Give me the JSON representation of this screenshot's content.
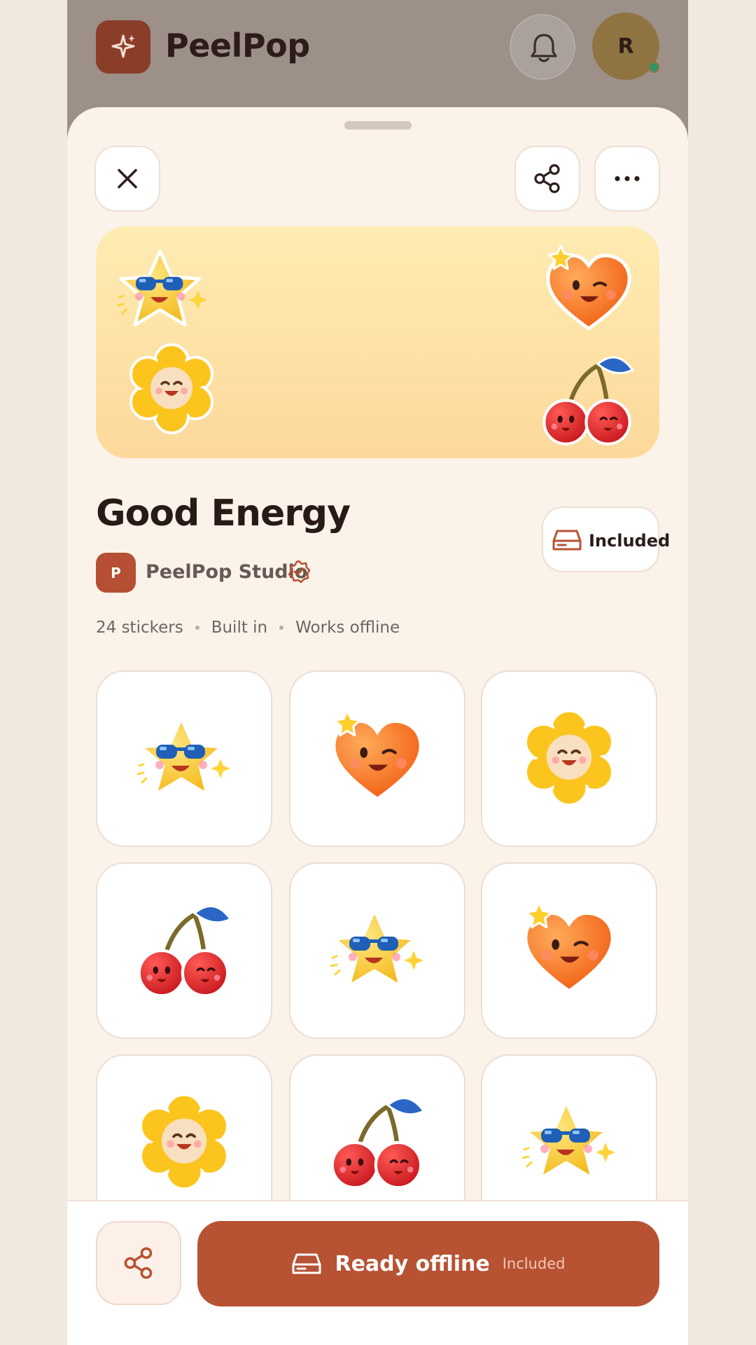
{
  "app": {
    "name": "PeelPop",
    "avatar_initial": "R",
    "icons": {
      "logo": "sparkle-icon",
      "notifications": "bell-icon"
    }
  },
  "sheet": {
    "close_icon": "close-icon",
    "share_icon": "share-icon",
    "more_icon": "more-horizontal-icon"
  },
  "pack": {
    "title": "Good Energy",
    "creator_initial": "P",
    "creator_name": "PeelPop Studio",
    "verified_icon": "verified-badge-icon",
    "status_chip": "Included",
    "meta": [
      "24 stickers",
      "Built in",
      "Works offline"
    ],
    "banner_stickers": [
      "star-sunglasses",
      "heart-wink",
      "flower-smile",
      "cherries-smile"
    ]
  },
  "stickers": [
    "star-sunglasses",
    "heart-wink",
    "flower-smile",
    "cherries-smile",
    "star-sunglasses",
    "heart-wink",
    "flower-smile",
    "cherries-smile",
    "star-sunglasses"
  ],
  "bottom_bar": {
    "primary_label": "Ready offline",
    "primary_sublabel": "Included",
    "primary_icon": "storage-drive-icon",
    "share_icon": "share-icon"
  },
  "colors": {
    "brand": "#b75233",
    "sheet_bg": "#fbf3ea",
    "banner_top": "#feecb2",
    "banner_bottom": "#fdd89b",
    "online": "#2f9466"
  }
}
